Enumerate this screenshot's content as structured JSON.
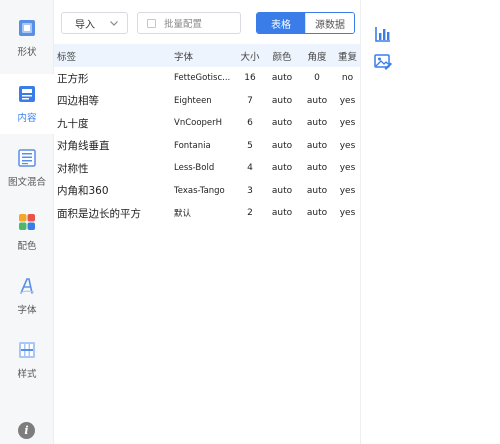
{
  "sidebar": {
    "items": [
      {
        "label": "形状",
        "icon": "shape-icon"
      },
      {
        "label": "内容",
        "icon": "content-icon"
      },
      {
        "label": "图文混合",
        "icon": "image-text-icon"
      },
      {
        "label": "配色",
        "icon": "palette-icon"
      },
      {
        "label": "字体",
        "icon": "font-icon"
      },
      {
        "label": "样式",
        "icon": "style-icon"
      }
    ],
    "active_index": 1
  },
  "toolbar": {
    "import_label": "导入",
    "batch_label": "批量配置",
    "tab_table": "表格",
    "tab_source": "源数据"
  },
  "table": {
    "headers": {
      "label": "标签",
      "font": "字体",
      "size": "大小",
      "color": "颜色",
      "angle": "角度",
      "repeat": "重复"
    },
    "rows": [
      {
        "label": "正方形",
        "font": "FetteGotisc...",
        "size": "16",
        "color": "auto",
        "angle": "0",
        "repeat": "no"
      },
      {
        "label": "四边相等",
        "font": "Eighteen",
        "size": "7",
        "color": "auto",
        "angle": "auto",
        "repeat": "yes"
      },
      {
        "label": "九十度",
        "font": "VnCooperH",
        "size": "6",
        "color": "auto",
        "angle": "auto",
        "repeat": "yes"
      },
      {
        "label": "对角线垂直",
        "font": "Fontania",
        "size": "5",
        "color": "auto",
        "angle": "auto",
        "repeat": "yes"
      },
      {
        "label": "对称性",
        "font": "Less-Bold",
        "size": "4",
        "color": "auto",
        "angle": "auto",
        "repeat": "yes"
      },
      {
        "label": "内角和360",
        "font": "Texas-Tango",
        "size": "3",
        "color": "auto",
        "angle": "auto",
        "repeat": "yes"
      },
      {
        "label": "面积是边长的平方",
        "font": "默认",
        "size": "2",
        "color": "auto",
        "angle": "auto",
        "repeat": "yes"
      }
    ]
  },
  "right_toolbar": {
    "icons": [
      "bar-chart-icon",
      "image-edit-icon"
    ]
  },
  "colors": {
    "accent": "#3a7de8",
    "header_bg": "#eef4fd",
    "sidebar_bg": "#f6f7f9"
  }
}
